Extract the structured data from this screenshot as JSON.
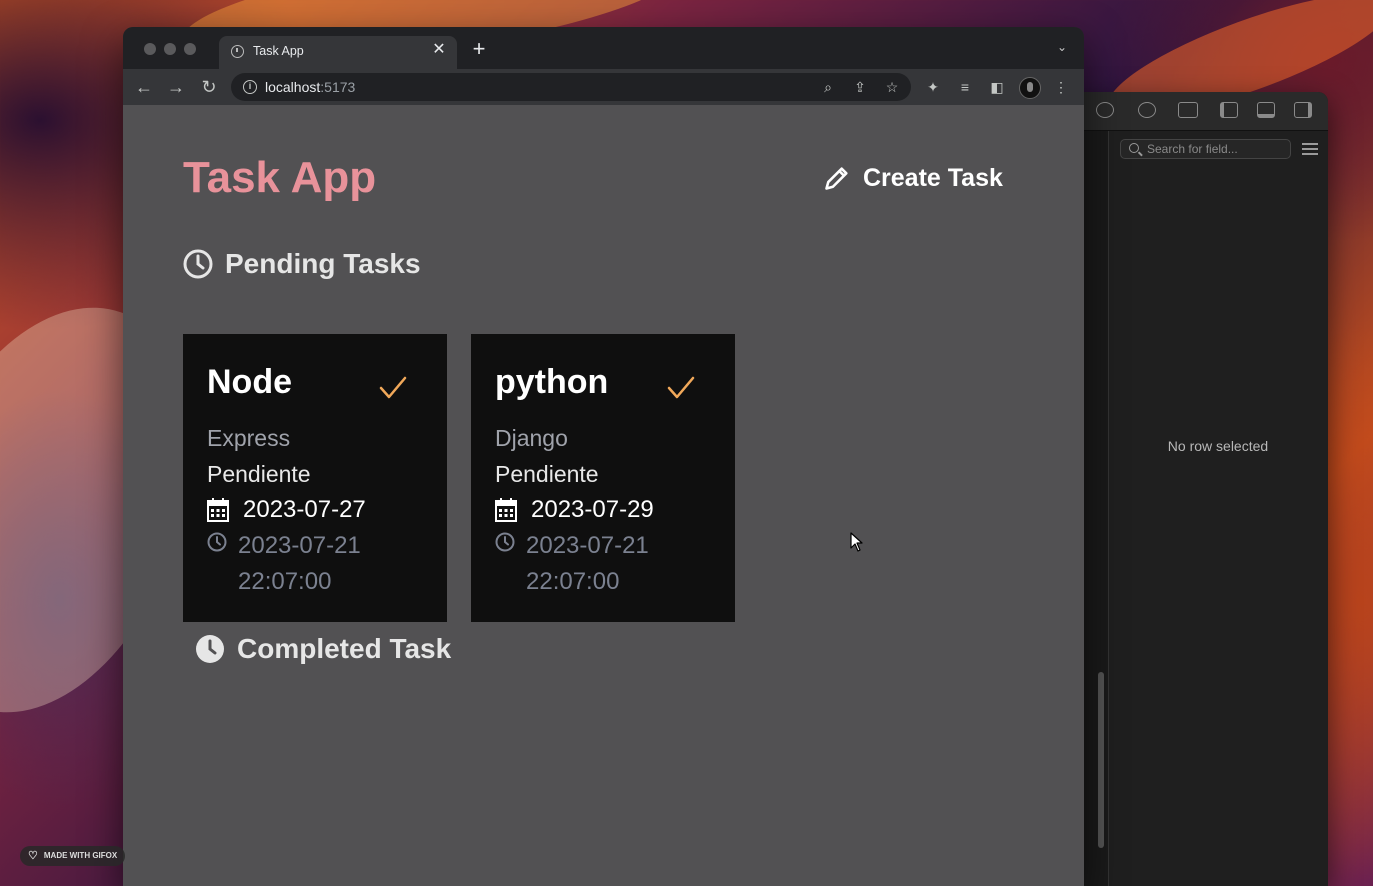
{
  "browser": {
    "tab_title": "Task App",
    "url_host": "localhost",
    "url_port": ":5173"
  },
  "page": {
    "app_title": "Task App",
    "create_task_label": "Create Task",
    "pending_section": "Pending Tasks",
    "completed_section": "Completed Task",
    "tasks": [
      {
        "title": "Node",
        "description": "Express",
        "status": "Pendiente",
        "due_date": "2023-07-27",
        "created_date": "2023-07-21",
        "created_time": "22:07:00"
      },
      {
        "title": "python",
        "description": "Django",
        "status": "Pendiente",
        "due_date": "2023-07-29",
        "created_date": "2023-07-21",
        "created_time": "22:07:00"
      }
    ]
  },
  "db_panel": {
    "search_placeholder": "Search for field...",
    "empty_state": "No row selected"
  },
  "watermark": "MADE WITH GIFOX",
  "colors": {
    "app_title": "#e8929a",
    "check": "#f0a85a",
    "page_bg": "#525153",
    "card_bg": "#0f0f0f"
  }
}
